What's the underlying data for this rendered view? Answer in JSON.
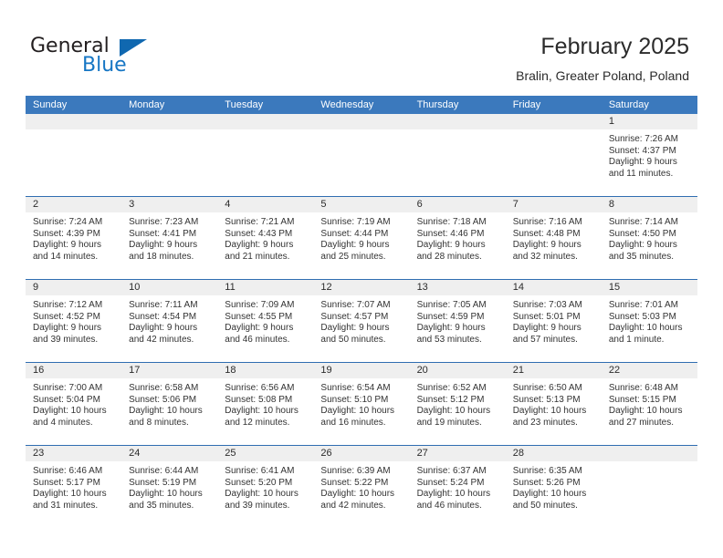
{
  "brand": {
    "name_top": "General",
    "name_bottom": "Blue",
    "accent_color": "#1676c4"
  },
  "header": {
    "title": "February 2025",
    "location": "Bralin, Greater Poland, Poland"
  },
  "theme": {
    "header_row_bg": "#3b79bd",
    "row_divider": "#2f6db1",
    "cell_head_bg": "#efefef"
  },
  "weekdays": [
    "Sunday",
    "Monday",
    "Tuesday",
    "Wednesday",
    "Thursday",
    "Friday",
    "Saturday"
  ],
  "weeks": [
    [
      {
        "day": "",
        "empty": true
      },
      {
        "day": "",
        "empty": true
      },
      {
        "day": "",
        "empty": true
      },
      {
        "day": "",
        "empty": true
      },
      {
        "day": "",
        "empty": true
      },
      {
        "day": "",
        "empty": true
      },
      {
        "day": "1",
        "sunrise": "Sunrise: 7:26 AM",
        "sunset": "Sunset: 4:37 PM",
        "daylight1": "Daylight: 9 hours",
        "daylight2": "and 11 minutes."
      }
    ],
    [
      {
        "day": "2",
        "sunrise": "Sunrise: 7:24 AM",
        "sunset": "Sunset: 4:39 PM",
        "daylight1": "Daylight: 9 hours",
        "daylight2": "and 14 minutes."
      },
      {
        "day": "3",
        "sunrise": "Sunrise: 7:23 AM",
        "sunset": "Sunset: 4:41 PM",
        "daylight1": "Daylight: 9 hours",
        "daylight2": "and 18 minutes."
      },
      {
        "day": "4",
        "sunrise": "Sunrise: 7:21 AM",
        "sunset": "Sunset: 4:43 PM",
        "daylight1": "Daylight: 9 hours",
        "daylight2": "and 21 minutes."
      },
      {
        "day": "5",
        "sunrise": "Sunrise: 7:19 AM",
        "sunset": "Sunset: 4:44 PM",
        "daylight1": "Daylight: 9 hours",
        "daylight2": "and 25 minutes."
      },
      {
        "day": "6",
        "sunrise": "Sunrise: 7:18 AM",
        "sunset": "Sunset: 4:46 PM",
        "daylight1": "Daylight: 9 hours",
        "daylight2": "and 28 minutes."
      },
      {
        "day": "7",
        "sunrise": "Sunrise: 7:16 AM",
        "sunset": "Sunset: 4:48 PM",
        "daylight1": "Daylight: 9 hours",
        "daylight2": "and 32 minutes."
      },
      {
        "day": "8",
        "sunrise": "Sunrise: 7:14 AM",
        "sunset": "Sunset: 4:50 PM",
        "daylight1": "Daylight: 9 hours",
        "daylight2": "and 35 minutes."
      }
    ],
    [
      {
        "day": "9",
        "sunrise": "Sunrise: 7:12 AM",
        "sunset": "Sunset: 4:52 PM",
        "daylight1": "Daylight: 9 hours",
        "daylight2": "and 39 minutes."
      },
      {
        "day": "10",
        "sunrise": "Sunrise: 7:11 AM",
        "sunset": "Sunset: 4:54 PM",
        "daylight1": "Daylight: 9 hours",
        "daylight2": "and 42 minutes."
      },
      {
        "day": "11",
        "sunrise": "Sunrise: 7:09 AM",
        "sunset": "Sunset: 4:55 PM",
        "daylight1": "Daylight: 9 hours",
        "daylight2": "and 46 minutes."
      },
      {
        "day": "12",
        "sunrise": "Sunrise: 7:07 AM",
        "sunset": "Sunset: 4:57 PM",
        "daylight1": "Daylight: 9 hours",
        "daylight2": "and 50 minutes."
      },
      {
        "day": "13",
        "sunrise": "Sunrise: 7:05 AM",
        "sunset": "Sunset: 4:59 PM",
        "daylight1": "Daylight: 9 hours",
        "daylight2": "and 53 minutes."
      },
      {
        "day": "14",
        "sunrise": "Sunrise: 7:03 AM",
        "sunset": "Sunset: 5:01 PM",
        "daylight1": "Daylight: 9 hours",
        "daylight2": "and 57 minutes."
      },
      {
        "day": "15",
        "sunrise": "Sunrise: 7:01 AM",
        "sunset": "Sunset: 5:03 PM",
        "daylight1": "Daylight: 10 hours",
        "daylight2": "and 1 minute."
      }
    ],
    [
      {
        "day": "16",
        "sunrise": "Sunrise: 7:00 AM",
        "sunset": "Sunset: 5:04 PM",
        "daylight1": "Daylight: 10 hours",
        "daylight2": "and 4 minutes."
      },
      {
        "day": "17",
        "sunrise": "Sunrise: 6:58 AM",
        "sunset": "Sunset: 5:06 PM",
        "daylight1": "Daylight: 10 hours",
        "daylight2": "and 8 minutes."
      },
      {
        "day": "18",
        "sunrise": "Sunrise: 6:56 AM",
        "sunset": "Sunset: 5:08 PM",
        "daylight1": "Daylight: 10 hours",
        "daylight2": "and 12 minutes."
      },
      {
        "day": "19",
        "sunrise": "Sunrise: 6:54 AM",
        "sunset": "Sunset: 5:10 PM",
        "daylight1": "Daylight: 10 hours",
        "daylight2": "and 16 minutes."
      },
      {
        "day": "20",
        "sunrise": "Sunrise: 6:52 AM",
        "sunset": "Sunset: 5:12 PM",
        "daylight1": "Daylight: 10 hours",
        "daylight2": "and 19 minutes."
      },
      {
        "day": "21",
        "sunrise": "Sunrise: 6:50 AM",
        "sunset": "Sunset: 5:13 PM",
        "daylight1": "Daylight: 10 hours",
        "daylight2": "and 23 minutes."
      },
      {
        "day": "22",
        "sunrise": "Sunrise: 6:48 AM",
        "sunset": "Sunset: 5:15 PM",
        "daylight1": "Daylight: 10 hours",
        "daylight2": "and 27 minutes."
      }
    ],
    [
      {
        "day": "23",
        "sunrise": "Sunrise: 6:46 AM",
        "sunset": "Sunset: 5:17 PM",
        "daylight1": "Daylight: 10 hours",
        "daylight2": "and 31 minutes."
      },
      {
        "day": "24",
        "sunrise": "Sunrise: 6:44 AM",
        "sunset": "Sunset: 5:19 PM",
        "daylight1": "Daylight: 10 hours",
        "daylight2": "and 35 minutes."
      },
      {
        "day": "25",
        "sunrise": "Sunrise: 6:41 AM",
        "sunset": "Sunset: 5:20 PM",
        "daylight1": "Daylight: 10 hours",
        "daylight2": "and 39 minutes."
      },
      {
        "day": "26",
        "sunrise": "Sunrise: 6:39 AM",
        "sunset": "Sunset: 5:22 PM",
        "daylight1": "Daylight: 10 hours",
        "daylight2": "and 42 minutes."
      },
      {
        "day": "27",
        "sunrise": "Sunrise: 6:37 AM",
        "sunset": "Sunset: 5:24 PM",
        "daylight1": "Daylight: 10 hours",
        "daylight2": "and 46 minutes."
      },
      {
        "day": "28",
        "sunrise": "Sunrise: 6:35 AM",
        "sunset": "Sunset: 5:26 PM",
        "daylight1": "Daylight: 10 hours",
        "daylight2": "and 50 minutes."
      },
      {
        "day": "",
        "empty": true
      }
    ]
  ]
}
